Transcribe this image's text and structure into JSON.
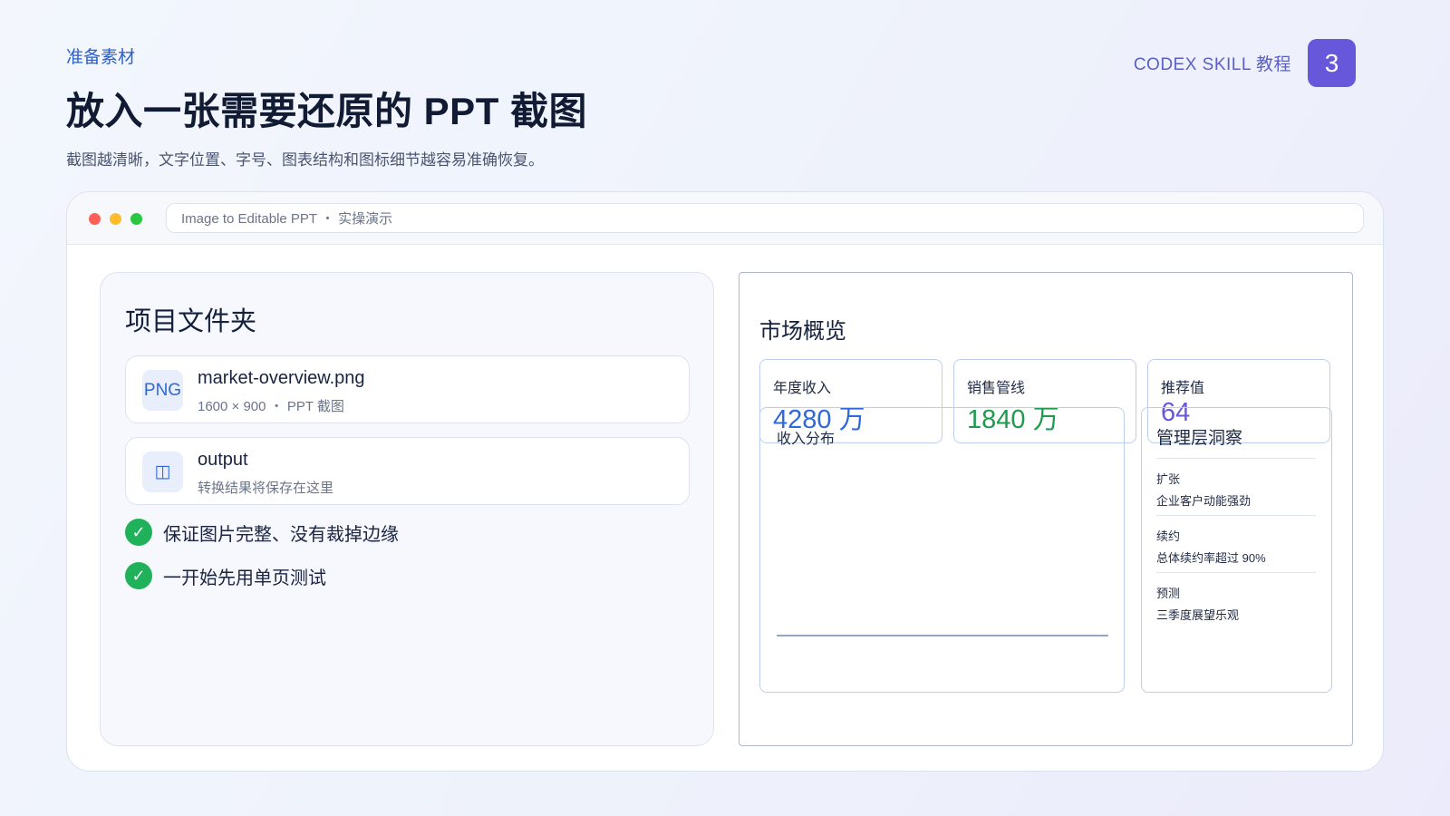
{
  "header": {
    "kicker": "准备素材",
    "title": "放入一张需要还原的 PPT 截图",
    "subtitle": "截图越清晰，文字位置、字号、图表结构和图标细节越容易准确恢复。"
  },
  "brand": {
    "text": "CODEX SKILL 教程",
    "page_number": "3"
  },
  "window": {
    "url_text": "Image to Editable PPT ・ 实操演示"
  },
  "left_panel": {
    "title": "项目文件夹",
    "files": [
      {
        "icon": "PNG",
        "name": "market-overview.png",
        "meta": "1600 × 900 ・ PPT 截图"
      },
      {
        "icon": "◫",
        "name": "output",
        "meta": "转换结果将保存在这里"
      }
    ],
    "checklist": [
      {
        "icon": "✓",
        "text": "保证图片完整、没有裁掉边缘"
      },
      {
        "icon": "✓",
        "text": "一开始先用单页测试"
      }
    ]
  },
  "right_panel": {
    "title": "市场概览",
    "kpis": [
      {
        "label": "年度收入",
        "value": "4280 万",
        "color": "#2f68d8"
      },
      {
        "label": "销售管线",
        "value": "1840 万",
        "color": "#1f9a4e"
      },
      {
        "label": "推荐值",
        "value": "64",
        "color": "#6657db"
      }
    ],
    "chart": {
      "title": "收入分布"
    },
    "insights": {
      "title": "管理层洞察",
      "items": [
        {
          "label": "扩张",
          "desc": "企业客户动能强劲"
        },
        {
          "label": "续约",
          "desc": "总体续约率超过 90%"
        },
        {
          "label": "预测",
          "desc": "三季度展望乐观"
        }
      ]
    }
  },
  "colors": {
    "accent": "#6657db",
    "link_blue": "#2b5fc9",
    "success_green": "#20b25a"
  }
}
